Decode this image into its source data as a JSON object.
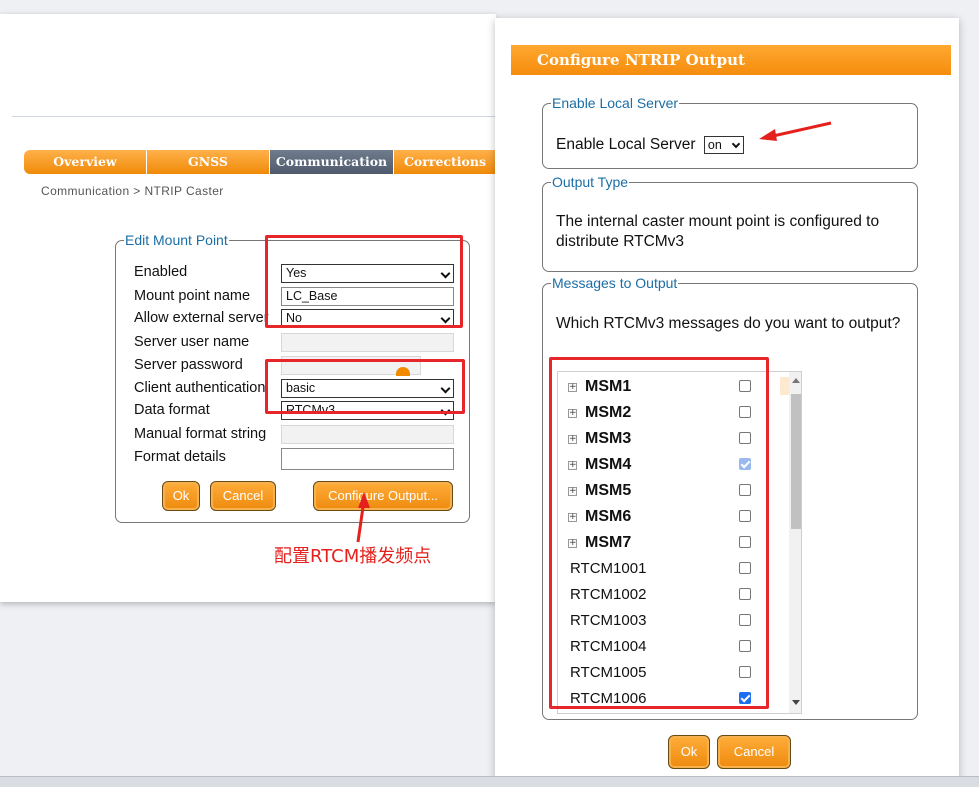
{
  "nav": {
    "tabs": [
      {
        "label": "Overview"
      },
      {
        "label": "GNSS"
      },
      {
        "label": "Communication"
      },
      {
        "label": "Corrections"
      }
    ]
  },
  "breadcrumb": "Communication > NTRIP Caster",
  "mount_point": {
    "legend": "Edit Mount Point",
    "fields": {
      "enabled": {
        "label": "Enabled",
        "value": "Yes"
      },
      "mount_point_name": {
        "label": "Mount point name",
        "value": "LC_Base"
      },
      "allow_external_server": {
        "label": "Allow external server",
        "value": "No"
      },
      "server_user_name": {
        "label": "Server user name",
        "value": ""
      },
      "server_password": {
        "label": "Server password",
        "value": ""
      },
      "client_authentication": {
        "label": "Client authentication",
        "value": "basic"
      },
      "data_format": {
        "label": "Data format",
        "value": "RTCMv3"
      },
      "manual_format_string": {
        "label": "Manual format string",
        "value": ""
      },
      "format_details": {
        "label": "Format details",
        "value": ""
      }
    },
    "buttons": {
      "ok": "Ok",
      "cancel": "Cancel",
      "configure_output": "Configure Output..."
    }
  },
  "annotation": {
    "text": "配置RTCM播发频点",
    "color": "#e4211c"
  },
  "config_output": {
    "title": "Configure NTRIP Output",
    "enable_local_server": {
      "legend": "Enable Local Server",
      "label": "Enable Local Server",
      "value": "on"
    },
    "output_type": {
      "legend": "Output Type",
      "text": "The internal caster mount point is configured to distribute RTCMv3"
    },
    "messages": {
      "legend": "Messages to Output",
      "question": "Which RTCMv3 messages do you want to output?",
      "items": [
        {
          "label": "MSM1",
          "group": true,
          "checked": false
        },
        {
          "label": "MSM2",
          "group": true,
          "checked": false
        },
        {
          "label": "MSM3",
          "group": true,
          "checked": false
        },
        {
          "label": "MSM4",
          "group": true,
          "checked": true,
          "partial": true
        },
        {
          "label": "MSM5",
          "group": true,
          "checked": false
        },
        {
          "label": "MSM6",
          "group": true,
          "checked": false
        },
        {
          "label": "MSM7",
          "group": true,
          "checked": false
        },
        {
          "label": "RTCM1001",
          "group": false,
          "checked": false
        },
        {
          "label": "RTCM1002",
          "group": false,
          "checked": false
        },
        {
          "label": "RTCM1003",
          "group": false,
          "checked": false
        },
        {
          "label": "RTCM1004",
          "group": false,
          "checked": false
        },
        {
          "label": "RTCM1005",
          "group": false,
          "checked": false
        },
        {
          "label": "RTCM1006",
          "group": false,
          "checked": true
        }
      ]
    },
    "buttons": {
      "ok": "Ok",
      "cancel": "Cancel"
    }
  },
  "colors": {
    "accent_orange": "#f58c0e",
    "active_tab": "#4f5b6c",
    "legend_blue": "#1b6ea5",
    "annotation_red": "#e6262b",
    "checkbox_blue": "#1d6ff2"
  }
}
